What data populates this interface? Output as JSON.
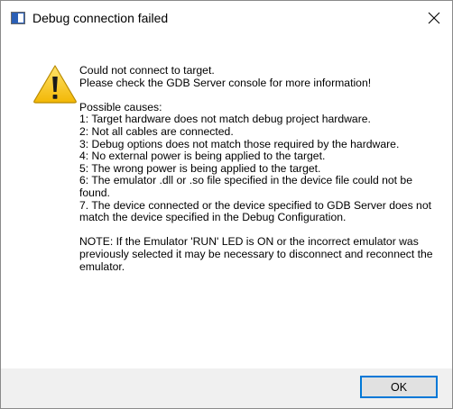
{
  "window": {
    "title": "Debug connection failed",
    "close_glyph": "✕",
    "app_icon": "app-window-icon"
  },
  "icon": "warning-icon",
  "message": {
    "line1": "Could not connect to target.",
    "line2": "Please check the GDB Server console for more information!",
    "causes_heading": "Possible causes:",
    "causes": [
      "1: Target hardware does not match debug project hardware.",
      "2: Not all cables are connected.",
      "3: Debug options does not match those required by the hardware.",
      "4: No external power is being applied to the target.",
      "5: The wrong power is being applied to the target.",
      "6: The emulator .dll or .so file specified in the device file could not be found.",
      "7. The device connected or the device specified to GDB Server does not match the device specified in the Debug Configuration."
    ],
    "note": "NOTE: If the Emulator 'RUN' LED is ON or the incorrect emulator was previously selected it may be necessary to disconnect and reconnect the emulator."
  },
  "buttons": {
    "ok_label": "OK"
  },
  "colors": {
    "accent": "#0078d7",
    "warning_fill": "#f5c518",
    "window_bg": "#ffffff",
    "footer_bg": "#f0f0f0"
  }
}
